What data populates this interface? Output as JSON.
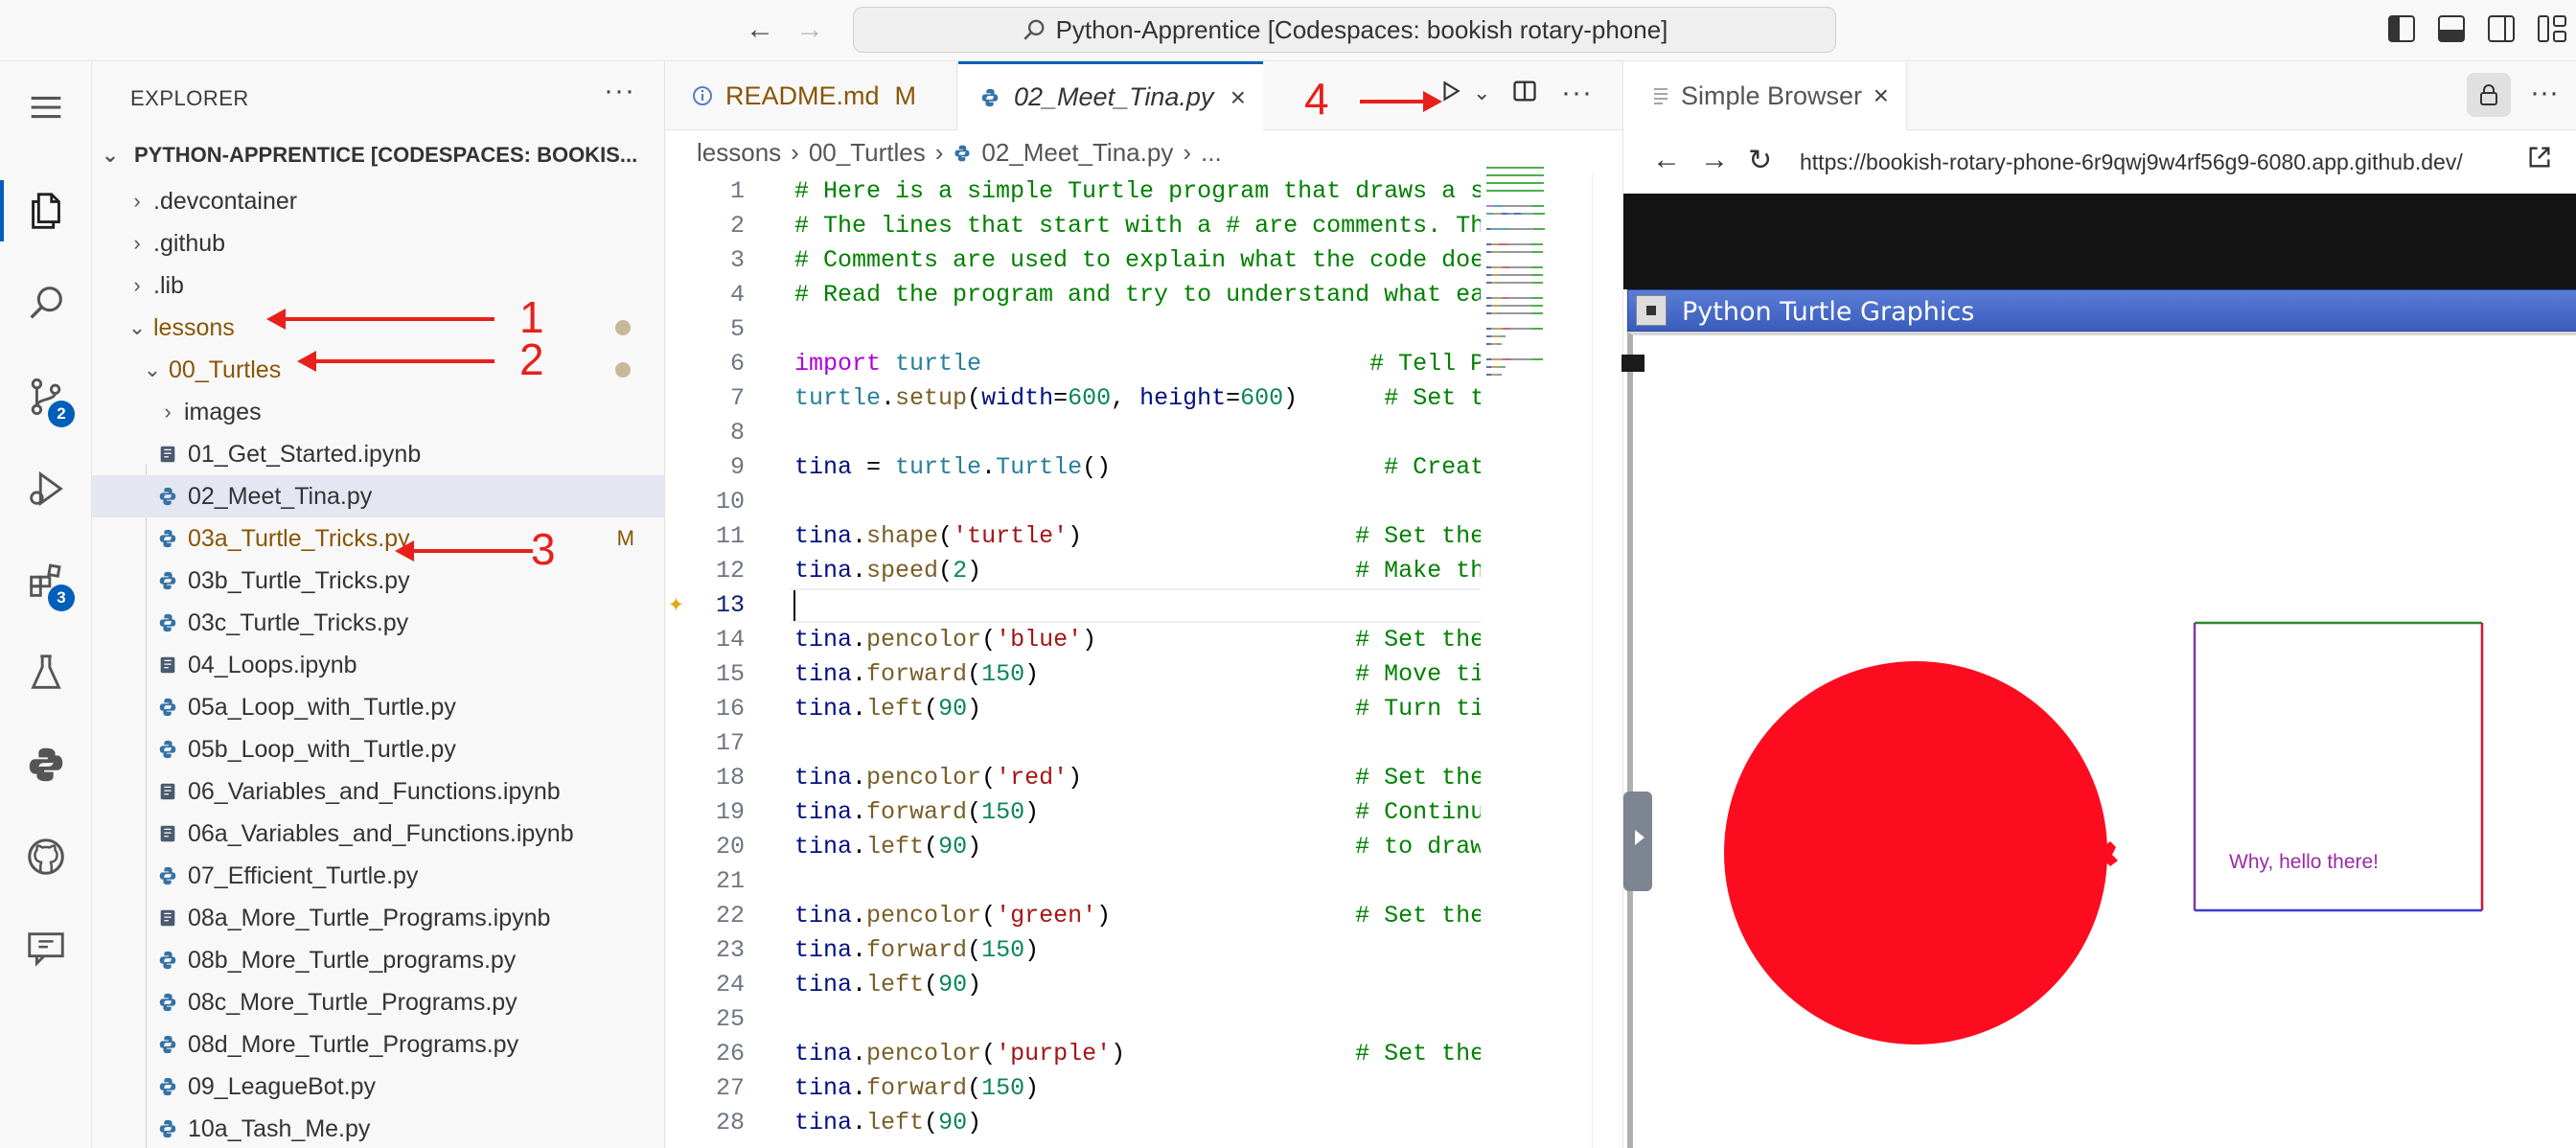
{
  "titlebar": {
    "command_center": "Python-Apprentice [Codespaces: bookish rotary-phone]"
  },
  "activity_bar": {
    "scm_badge": "2",
    "extensions_badge": "3"
  },
  "explorer": {
    "title": "EXPLORER",
    "more": "···",
    "root": "PYTHON-APPRENTICE [CODESPACES: BOOKIS...",
    "items": [
      {
        "label": ".devcontainer",
        "kind": "folder",
        "state": "collapsed",
        "level": 1
      },
      {
        "label": ".github",
        "kind": "folder",
        "state": "collapsed",
        "level": 1
      },
      {
        "label": ".lib",
        "kind": "folder",
        "state": "collapsed",
        "level": 1
      },
      {
        "label": "lessons",
        "kind": "folder",
        "state": "expanded",
        "level": 1,
        "modified": true
      },
      {
        "label": "00_Turtles",
        "kind": "folder",
        "state": "expanded",
        "level": 2,
        "modified": true
      },
      {
        "label": "images",
        "kind": "folder",
        "state": "collapsed",
        "level": 3
      },
      {
        "label": "01_Get_Started.ipynb",
        "kind": "notebook",
        "level": 3
      },
      {
        "label": "02_Meet_Tina.py",
        "kind": "python",
        "level": 3,
        "selected": true
      },
      {
        "label": "03a_Turtle_Tricks.py",
        "kind": "python",
        "level": 3,
        "git": "M"
      },
      {
        "label": "03b_Turtle_Tricks.py",
        "kind": "python",
        "level": 3
      },
      {
        "label": "03c_Turtle_Tricks.py",
        "kind": "python",
        "level": 3
      },
      {
        "label": "04_Loops.ipynb",
        "kind": "notebook",
        "level": 3
      },
      {
        "label": "05a_Loop_with_Turtle.py",
        "kind": "python",
        "level": 3
      },
      {
        "label": "05b_Loop_with_Turtle.py",
        "kind": "python",
        "level": 3
      },
      {
        "label": "06_Variables_and_Functions.ipynb",
        "kind": "notebook",
        "level": 3
      },
      {
        "label": "06a_Variables_and_Functions.ipynb",
        "kind": "notebook",
        "level": 3
      },
      {
        "label": "07_Efficient_Turtle.py",
        "kind": "python",
        "level": 3
      },
      {
        "label": "08a_More_Turtle_Programs.ipynb",
        "kind": "notebook",
        "level": 3
      },
      {
        "label": "08b_More_Turtle_programs.py",
        "kind": "python",
        "level": 3
      },
      {
        "label": "08c_More_Turtle_Programs.py",
        "kind": "python",
        "level": 3
      },
      {
        "label": "08d_More_Turtle_Programs.py",
        "kind": "python",
        "level": 3
      },
      {
        "label": "09_LeagueBot.py",
        "kind": "python",
        "level": 3
      },
      {
        "label": "10a_Tash_Me.py",
        "kind": "python",
        "level": 3
      }
    ]
  },
  "annotations": [
    "1",
    "2",
    "3",
    "4"
  ],
  "editor": {
    "tabs": [
      {
        "label": "README.md",
        "badge": "M"
      },
      {
        "label": "02_Meet_Tina.py"
      }
    ],
    "breadcrumb": [
      "lessons",
      "00_Turtles",
      "02_Meet_Tina.py",
      "..."
    ],
    "current_line": 13,
    "lines": [
      {
        "n": "1",
        "t": [
          [
            "c-comment",
            "# Here is a simple Turtle program that draws a squ"
          ]
        ]
      },
      {
        "n": "2",
        "t": [
          [
            "c-comment",
            "# The lines that start with a # are comments. They"
          ]
        ]
      },
      {
        "n": "3",
        "t": [
          [
            "c-comment",
            "# Comments are used to explain what the code does."
          ]
        ]
      },
      {
        "n": "4",
        "t": [
          [
            "c-comment",
            "# Read the program and try to understand what each"
          ]
        ]
      },
      {
        "n": "5",
        "t": []
      },
      {
        "n": "6",
        "t": [
          [
            "c-keyword",
            "import"
          ],
          [
            "c-plain",
            " "
          ],
          [
            "c-ident",
            "turtle"
          ],
          [
            "c-plain",
            "                           "
          ],
          [
            "c-comment",
            "# Tell Pyt"
          ]
        ]
      },
      {
        "n": "7",
        "t": [
          [
            "c-ident",
            "turtle"
          ],
          [
            "c-plain",
            "."
          ],
          [
            "c-func",
            "setup"
          ],
          [
            "c-plain",
            "("
          ],
          [
            "c-var",
            "width"
          ],
          [
            "c-plain",
            "="
          ],
          [
            "c-num",
            "600"
          ],
          [
            "c-plain",
            ", "
          ],
          [
            "c-var",
            "height"
          ],
          [
            "c-plain",
            "="
          ],
          [
            "c-num",
            "600"
          ],
          [
            "c-plain",
            ")      "
          ],
          [
            "c-comment",
            "# Set the "
          ]
        ]
      },
      {
        "n": "8",
        "t": []
      },
      {
        "n": "9",
        "t": [
          [
            "c-var",
            "tina"
          ],
          [
            "c-plain",
            " = "
          ],
          [
            "c-ident",
            "turtle"
          ],
          [
            "c-plain",
            "."
          ],
          [
            "c-ident",
            "Turtle"
          ],
          [
            "c-plain",
            "()                   "
          ],
          [
            "c-comment",
            "# Create a"
          ]
        ]
      },
      {
        "n": "10",
        "t": []
      },
      {
        "n": "11",
        "t": [
          [
            "c-var",
            "tina"
          ],
          [
            "c-plain",
            "."
          ],
          [
            "c-func",
            "shape"
          ],
          [
            "c-plain",
            "("
          ],
          [
            "c-str",
            "'turtle'"
          ],
          [
            "c-plain",
            ")                   "
          ],
          [
            "c-comment",
            "# Set the "
          ]
        ]
      },
      {
        "n": "12",
        "t": [
          [
            "c-var",
            "tina"
          ],
          [
            "c-plain",
            "."
          ],
          [
            "c-func",
            "speed"
          ],
          [
            "c-plain",
            "("
          ],
          [
            "c-num",
            "2"
          ],
          [
            "c-plain",
            ")                          "
          ],
          [
            "c-comment",
            "# Make the"
          ]
        ]
      },
      {
        "n": "13",
        "t": []
      },
      {
        "n": "14",
        "t": [
          [
            "c-var",
            "tina"
          ],
          [
            "c-plain",
            "."
          ],
          [
            "c-func",
            "pencolor"
          ],
          [
            "c-plain",
            "("
          ],
          [
            "c-str",
            "'blue'"
          ],
          [
            "c-plain",
            ")                  "
          ],
          [
            "c-comment",
            "# Set the "
          ]
        ]
      },
      {
        "n": "15",
        "t": [
          [
            "c-var",
            "tina"
          ],
          [
            "c-plain",
            "."
          ],
          [
            "c-func",
            "forward"
          ],
          [
            "c-plain",
            "("
          ],
          [
            "c-num",
            "150"
          ],
          [
            "c-plain",
            ")                      "
          ],
          [
            "c-comment",
            "# Move tin"
          ]
        ]
      },
      {
        "n": "16",
        "t": [
          [
            "c-var",
            "tina"
          ],
          [
            "c-plain",
            "."
          ],
          [
            "c-func",
            "left"
          ],
          [
            "c-plain",
            "("
          ],
          [
            "c-num",
            "90"
          ],
          [
            "c-plain",
            ")                          "
          ],
          [
            "c-comment",
            "# Turn tin"
          ]
        ]
      },
      {
        "n": "17",
        "t": []
      },
      {
        "n": "18",
        "t": [
          [
            "c-var",
            "tina"
          ],
          [
            "c-plain",
            "."
          ],
          [
            "c-func",
            "pencolor"
          ],
          [
            "c-plain",
            "("
          ],
          [
            "c-str",
            "'red'"
          ],
          [
            "c-plain",
            ")                   "
          ],
          [
            "c-comment",
            "# Set the "
          ]
        ]
      },
      {
        "n": "19",
        "t": [
          [
            "c-var",
            "tina"
          ],
          [
            "c-plain",
            "."
          ],
          [
            "c-func",
            "forward"
          ],
          [
            "c-plain",
            "("
          ],
          [
            "c-num",
            "150"
          ],
          [
            "c-plain",
            ")                      "
          ],
          [
            "c-comment",
            "# Continui"
          ]
        ]
      },
      {
        "n": "20",
        "t": [
          [
            "c-var",
            "tina"
          ],
          [
            "c-plain",
            "."
          ],
          [
            "c-func",
            "left"
          ],
          [
            "c-plain",
            "("
          ],
          [
            "c-num",
            "90"
          ],
          [
            "c-plain",
            ")                          "
          ],
          [
            "c-comment",
            "# to draw "
          ]
        ]
      },
      {
        "n": "21",
        "t": []
      },
      {
        "n": "22",
        "t": [
          [
            "c-var",
            "tina"
          ],
          [
            "c-plain",
            "."
          ],
          [
            "c-func",
            "pencolor"
          ],
          [
            "c-plain",
            "("
          ],
          [
            "c-str",
            "'green'"
          ],
          [
            "c-plain",
            ")                 "
          ],
          [
            "c-comment",
            "# Set the "
          ]
        ]
      },
      {
        "n": "23",
        "t": [
          [
            "c-var",
            "tina"
          ],
          [
            "c-plain",
            "."
          ],
          [
            "c-func",
            "forward"
          ],
          [
            "c-plain",
            "("
          ],
          [
            "c-num",
            "150"
          ],
          [
            "c-plain",
            ")"
          ]
        ]
      },
      {
        "n": "24",
        "t": [
          [
            "c-var",
            "tina"
          ],
          [
            "c-plain",
            "."
          ],
          [
            "c-func",
            "left"
          ],
          [
            "c-plain",
            "("
          ],
          [
            "c-num",
            "90"
          ],
          [
            "c-plain",
            ")"
          ]
        ]
      },
      {
        "n": "25",
        "t": []
      },
      {
        "n": "26",
        "t": [
          [
            "c-var",
            "tina"
          ],
          [
            "c-plain",
            "."
          ],
          [
            "c-func",
            "pencolor"
          ],
          [
            "c-plain",
            "("
          ],
          [
            "c-str",
            "'purple'"
          ],
          [
            "c-plain",
            ")                "
          ],
          [
            "c-comment",
            "# Set the "
          ]
        ]
      },
      {
        "n": "27",
        "t": [
          [
            "c-var",
            "tina"
          ],
          [
            "c-plain",
            "."
          ],
          [
            "c-func",
            "forward"
          ],
          [
            "c-plain",
            "("
          ],
          [
            "c-num",
            "150"
          ],
          [
            "c-plain",
            ")"
          ]
        ]
      },
      {
        "n": "28",
        "t": [
          [
            "c-var",
            "tina"
          ],
          [
            "c-plain",
            "."
          ],
          [
            "c-func",
            "left"
          ],
          [
            "c-plain",
            "("
          ],
          [
            "c-num",
            "90"
          ],
          [
            "c-plain",
            ")"
          ]
        ]
      }
    ]
  },
  "browser": {
    "tab_label": "Simple Browser",
    "url": "https://bookish-rotary-phone-6r9qwj9w4rf56g9-6080.app.github.dev/",
    "window_title": "Python Turtle Graphics",
    "canvas_text": "Why, hello there!",
    "circle_color": "#fd0c1f",
    "square_colors": {
      "top": "#2a8a2a",
      "left": "#7a3aa0",
      "right": "#e01030",
      "bottom": "#3a3ad0"
    },
    "text_color": "#9a2aa8"
  },
  "colors": {
    "accent": "#005fb8",
    "annotation_red": "#e8201b",
    "selected_row": "#e4e6f1",
    "modified": "#895503"
  }
}
